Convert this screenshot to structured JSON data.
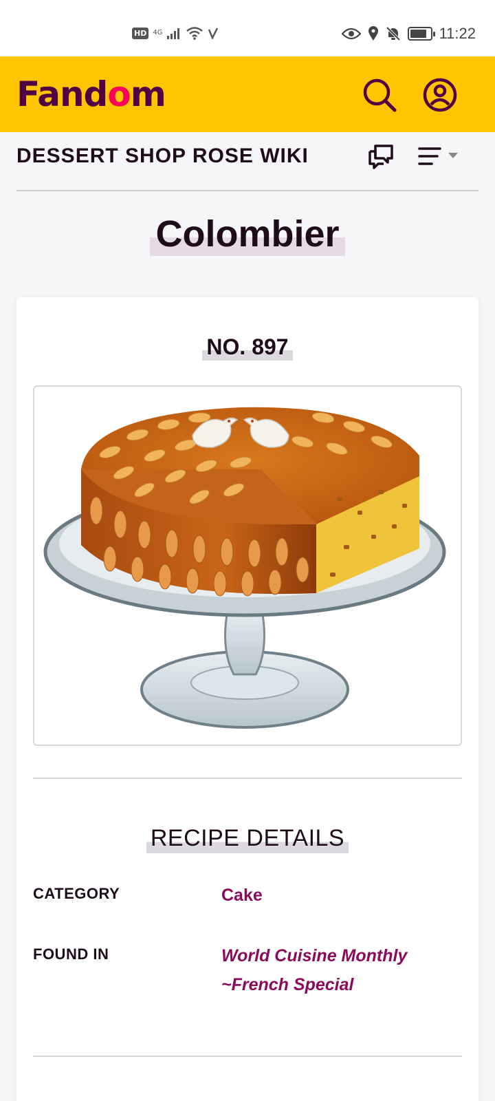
{
  "status_bar": {
    "hd": "HD",
    "network": "4G",
    "time": "11:22",
    "battery_level": 0.85
  },
  "header": {
    "logo_text_left": "Fand",
    "logo_text_flame": "o",
    "logo_text_right": "m",
    "search_icon": "search-icon",
    "account_icon": "user-circle-icon",
    "colors": {
      "bar": "#ffc500",
      "logo": "#520044",
      "flame": "#fa005a"
    }
  },
  "wiki_bar": {
    "name": "DESSERT SHOP ROSE WIKI",
    "discussions_icon": "discussions-icon",
    "menu_icon": "menu-lines-icon"
  },
  "page": {
    "title": "Colombier"
  },
  "infobox": {
    "number": "NO. 897",
    "image_alt": "Colombier cake",
    "section_title": "RECIPE DETAILS",
    "rows": [
      {
        "label": "CATEGORY",
        "value": "Cake"
      },
      {
        "label": "FOUND IN",
        "value_line1": "World Cuisine Monthly",
        "value_line2": "~French Special"
      }
    ],
    "link_color": "#8a0b5c"
  }
}
